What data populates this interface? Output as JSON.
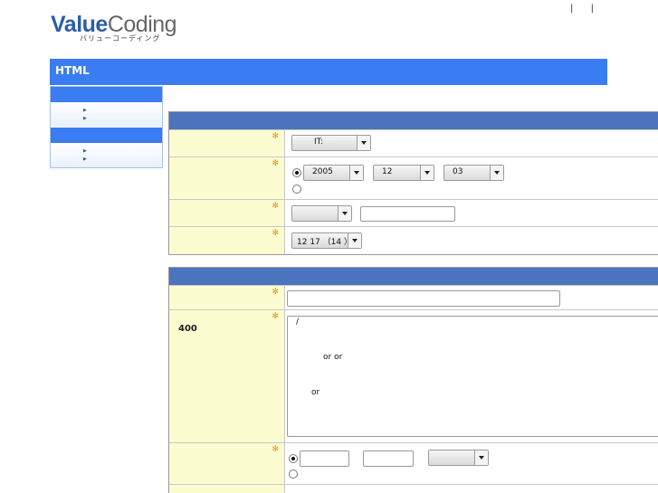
{
  "logo": {
    "word1": "Value",
    "word2": "Coding",
    "tagline": "バリューコーディング"
  },
  "header": {
    "link_sep_1": "|",
    "link_sep_2": "|"
  },
  "bluebar": {
    "title": "HTML"
  },
  "form1": {
    "category_select": "IT:",
    "date": {
      "year": "2005",
      "month": "12",
      "day": "03"
    },
    "age_select": "12 17 （14 ）"
  },
  "form2": {
    "limit_label": "400",
    "textarea_lines": [
      "/",
      "or    or",
      "or"
    ]
  },
  "colors": {
    "brand_blue": "#3a7cf2",
    "form_header": "#4c73bd",
    "label_bg": "#fbfdd0",
    "required_mark": "#f08c1a"
  },
  "icons": {
    "required": "required-star-icon",
    "sidebar_bullet": "triangle-right-icon"
  }
}
